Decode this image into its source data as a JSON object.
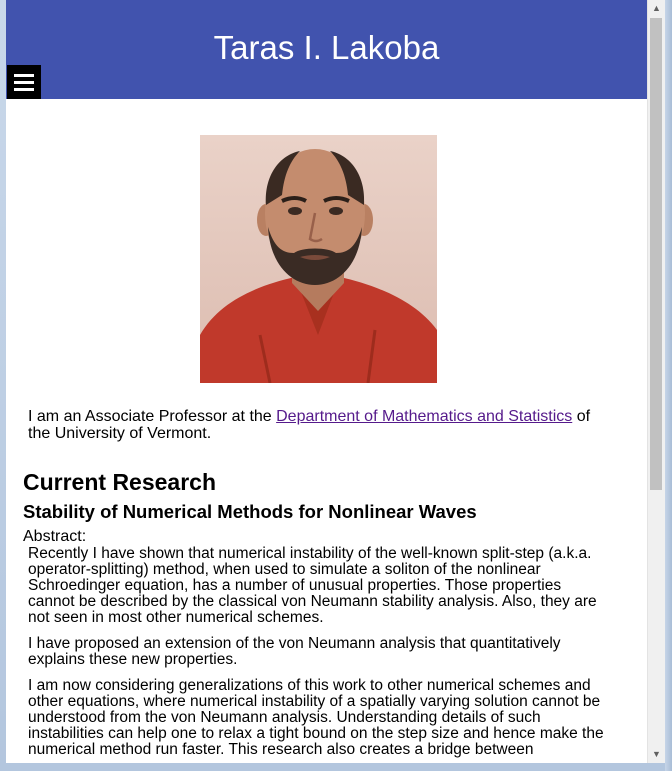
{
  "header": {
    "title": "Taras I. Lakoba",
    "menu_icon": "hamburger-menu-icon",
    "background_color": "#4153ae"
  },
  "intro": {
    "before_link": "I am an Associate Professor at the ",
    "link_text": "Department of Mathematics and Statistics",
    "after_link": " of the University of Vermont."
  },
  "research": {
    "heading": "Current Research",
    "subheading": "Stability of Numerical Methods for Nonlinear Waves",
    "abstract_label": "Abstract:",
    "paragraphs": [
      "Recently I have shown that numerical instability of the well-known split-step (a.k.a. operator-splitting) method, when used to simulate a soliton of the nonlinear Schroedinger equation, has a number of unusual properties. Those properties cannot be described by the classical von Neumann stability analysis. Also, they are not seen in most other numerical schemes.",
      "I have proposed an extension of the von Neumann analysis that quantitatively explains these new properties.",
      "I am now considering generalizations of this work to other numerical schemes and other equations, where numerical instability of a spatially varying solution cannot be understood from the von Neumann analysis. Understanding details of such instabilities can help one to relax a tight bound on the step size and hence make the numerical method run faster. This research also creates a bridge between"
    ]
  },
  "scrollbar": {
    "up_arrow": "▲",
    "down_arrow": "▼"
  }
}
